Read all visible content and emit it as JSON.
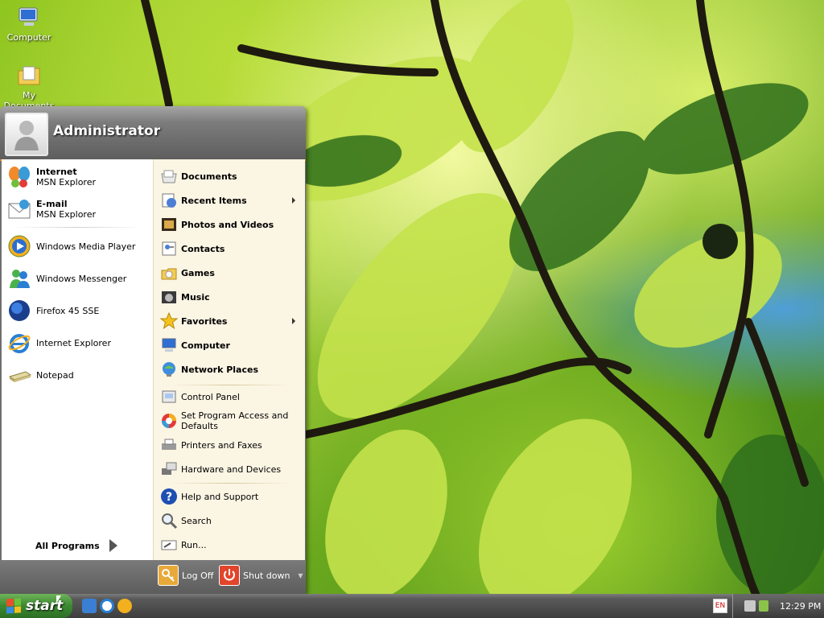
{
  "desktop": {
    "icons": [
      {
        "label": "Computer",
        "icon": "computer-icon"
      },
      {
        "label": "My Documents",
        "icon": "my-documents-icon"
      }
    ]
  },
  "start_menu": {
    "user": {
      "name": "Administrator",
      "avatar": "user-avatar-icon"
    },
    "pinned": [
      {
        "title": "Internet",
        "subtitle": "MSN Explorer",
        "icon": "msn-butterfly-icon"
      },
      {
        "title": "E-mail",
        "subtitle": "MSN Explorer",
        "icon": "email-icon"
      }
    ],
    "recent": [
      {
        "label": "Windows Media Player",
        "icon": "media-player-icon"
      },
      {
        "label": "Windows Messenger",
        "icon": "messenger-icon"
      },
      {
        "label": "Firefox 45 SSE",
        "icon": "firefox-icon"
      },
      {
        "label": "Internet Explorer",
        "icon": "internet-explorer-icon"
      },
      {
        "label": "Notepad",
        "icon": "notepad-icon"
      }
    ],
    "all_programs": "All Programs",
    "places": [
      {
        "label": "Documents",
        "icon": "documents-icon",
        "bold": true
      },
      {
        "label": "Recent Items",
        "icon": "recent-items-icon",
        "bold": true,
        "submenu": true
      },
      {
        "label": "Photos and Videos",
        "icon": "photos-videos-icon",
        "bold": true
      },
      {
        "label": "Contacts",
        "icon": "contacts-icon",
        "bold": true
      },
      {
        "label": "Games",
        "icon": "games-icon",
        "bold": true
      },
      {
        "label": "Music",
        "icon": "music-icon",
        "bold": true
      },
      {
        "label": "Favorites",
        "icon": "favorites-icon",
        "bold": true,
        "submenu": true
      },
      {
        "label": "Computer",
        "icon": "computer-icon",
        "bold": true
      },
      {
        "label": "Network Places",
        "icon": "network-places-icon",
        "bold": true
      }
    ],
    "settings": [
      {
        "label": "Control Panel",
        "icon": "control-panel-icon"
      },
      {
        "label": "Set Program Access and Defaults",
        "icon": "program-access-icon"
      },
      {
        "label": "Printers and Faxes",
        "icon": "printers-icon"
      },
      {
        "label": "Hardware and Devices",
        "icon": "hardware-icon"
      }
    ],
    "help": [
      {
        "label": "Help and Support",
        "icon": "help-icon"
      },
      {
        "label": "Search",
        "icon": "search-icon"
      },
      {
        "label": "Run...",
        "icon": "run-icon"
      }
    ],
    "footer": {
      "log_off": "Log Off",
      "shut_down": "Shut down"
    }
  },
  "taskbar": {
    "start_label": "start",
    "quick_launch": [
      "show-desktop-icon",
      "internet-explorer-icon",
      "media-player-icon"
    ],
    "language": "EN",
    "clock": "12:29 PM"
  },
  "colors": {
    "accent": "#e78a1f",
    "start_green": "#3f8c34",
    "menu_header": "#6e6e6e",
    "places_bg": "#fbf5e4"
  }
}
